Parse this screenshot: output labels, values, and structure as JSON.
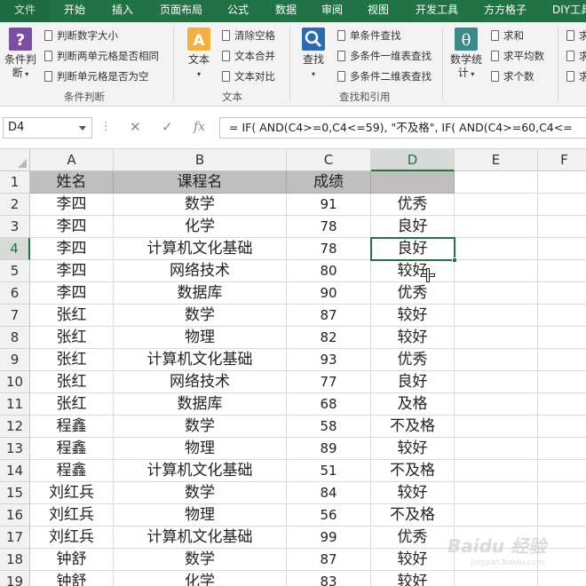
{
  "ribbon": {
    "tabs": [
      "文件",
      "开始",
      "插入",
      "页面布局",
      "公式",
      "数据",
      "审阅",
      "视图",
      "开发工具",
      "方方格子",
      "DIY工具"
    ],
    "groups": [
      {
        "label": "条件判断",
        "big_button": {
          "label": "条件判",
          "label2": "断",
          "icon": "question-icon",
          "color": "#7a4fa3"
        },
        "items": [
          "判断数字大小",
          "判断两单元格是否相同",
          "判断单元格是否为空"
        ]
      },
      {
        "label": "文本",
        "big_button": {
          "label": "文本",
          "icon": "text-a-icon",
          "color": "#f3b23c"
        },
        "items": [
          "清除空格",
          "文本合并",
          "文本对比"
        ]
      },
      {
        "label": "查找和引用",
        "big_button": {
          "label": "查找",
          "icon": "magnifier-icon",
          "color": "#2b6cb0"
        },
        "items": [
          "单条件查找",
          "多条件一维表查找",
          "多条件二维表查找"
        ]
      },
      {
        "label": "",
        "big_button": {
          "label": "数学统",
          "label2": "计",
          "icon": "theta-icon",
          "color": "#3a8a8a"
        },
        "items": [
          "求和",
          "求平均数",
          "求个数"
        ]
      }
    ],
    "overflow_items": [
      "求",
      "求",
      "求"
    ]
  },
  "formula_bar": {
    "name_box": "D4",
    "dots": "⋮",
    "cancel": "✕",
    "enter": "✓",
    "fx": "fx",
    "formula": "= IF(  AND(C4>=0,C4<=59), \"不及格\",  IF(  AND(C4>=60,C4<="
  },
  "grid": {
    "columns": [
      "A",
      "B",
      "C",
      "D",
      "E",
      "F"
    ],
    "selected_column": "D",
    "selected_row": 4,
    "selected_cell": "D4",
    "header_row": [
      "姓名",
      "课程名",
      "成绩",
      ""
    ],
    "rows": [
      {
        "n": "2",
        "a": "李四",
        "b": "数学",
        "c": "91",
        "d": "优秀"
      },
      {
        "n": "3",
        "a": "李四",
        "b": "化学",
        "c": "78",
        "d": "良好"
      },
      {
        "n": "4",
        "a": "李四",
        "b": "计算机文化基础",
        "c": "78",
        "d": "良好"
      },
      {
        "n": "5",
        "a": "李四",
        "b": "网络技术",
        "c": "80",
        "d": "较好"
      },
      {
        "n": "6",
        "a": "李四",
        "b": "数据库",
        "c": "90",
        "d": "优秀"
      },
      {
        "n": "7",
        "a": "张红",
        "b": "数学",
        "c": "87",
        "d": "较好"
      },
      {
        "n": "8",
        "a": "张红",
        "b": "物理",
        "c": "82",
        "d": "较好"
      },
      {
        "n": "9",
        "a": "张红",
        "b": "计算机文化基础",
        "c": "93",
        "d": "优秀"
      },
      {
        "n": "10",
        "a": "张红",
        "b": "网络技术",
        "c": "77",
        "d": "良好"
      },
      {
        "n": "11",
        "a": "张红",
        "b": "数据库",
        "c": "68",
        "d": "及格"
      },
      {
        "n": "12",
        "a": "程鑫",
        "b": "数学",
        "c": "58",
        "d": "不及格"
      },
      {
        "n": "13",
        "a": "程鑫",
        "b": "物理",
        "c": "89",
        "d": "较好"
      },
      {
        "n": "14",
        "a": "程鑫",
        "b": "计算机文化基础",
        "c": "51",
        "d": "不及格"
      },
      {
        "n": "15",
        "a": "刘红兵",
        "b": "数学",
        "c": "84",
        "d": "较好"
      },
      {
        "n": "16",
        "a": "刘红兵",
        "b": "物理",
        "c": "56",
        "d": "不及格"
      },
      {
        "n": "17",
        "a": "刘红兵",
        "b": "计算机文化基础",
        "c": "99",
        "d": "优秀"
      },
      {
        "n": "18",
        "a": "钟舒",
        "b": "数学",
        "c": "87",
        "d": "较好"
      },
      {
        "n": "19",
        "a": "钟舒",
        "b": "化学",
        "c": "83",
        "d": "较好"
      }
    ]
  },
  "watermark": {
    "line1": "Baidu 经验",
    "line2": "jingyan.baidu.com"
  },
  "colors": {
    "ribbon_green": "#217346",
    "header_fill": "#bfbfbf",
    "selection": "#217346"
  }
}
